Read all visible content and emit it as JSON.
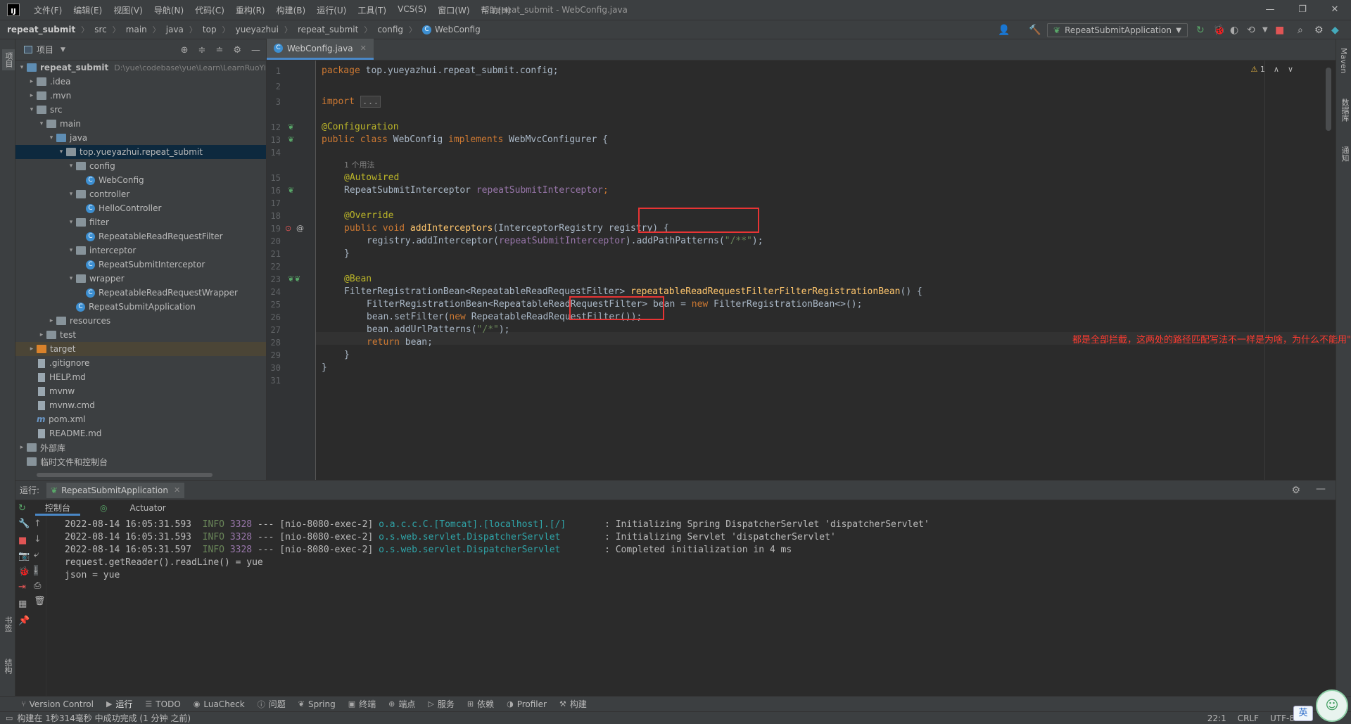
{
  "window": {
    "title": "repeat_submit - WebConfig.java",
    "menu": [
      "文件(F)",
      "编辑(E)",
      "视图(V)",
      "导航(N)",
      "代码(C)",
      "重构(R)",
      "构建(B)",
      "运行(U)",
      "工具(T)",
      "VCS(S)",
      "窗口(W)",
      "帮助(H)"
    ],
    "controls": {
      "minimize": "—",
      "maximize": "❐",
      "close": "✕"
    }
  },
  "breadcrumb": [
    "repeat_submit",
    "src",
    "main",
    "java",
    "top",
    "yueyazhui",
    "repeat_submit",
    "config",
    "WebConfig"
  ],
  "toolbar": {
    "run_config": "RepeatSubmitApplication"
  },
  "project_panel": {
    "title": "项目",
    "tree": [
      {
        "label": "repeat_submit",
        "hint": "D:\\yue\\codebase\\yue\\Learn\\LearnRuoYi",
        "depth": 0,
        "icon": "folder-blue",
        "arrow": "▾",
        "bold": true
      },
      {
        "label": ".idea",
        "depth": 1,
        "icon": "folder",
        "arrow": "▸"
      },
      {
        "label": ".mvn",
        "depth": 1,
        "icon": "folder",
        "arrow": "▸"
      },
      {
        "label": "src",
        "depth": 1,
        "icon": "folder",
        "arrow": "▾"
      },
      {
        "label": "main",
        "depth": 2,
        "icon": "folder",
        "arrow": "▾"
      },
      {
        "label": "java",
        "depth": 3,
        "icon": "folder-src",
        "arrow": "▾"
      },
      {
        "label": "top.yueyazhui.repeat_submit",
        "depth": 4,
        "icon": "pkg",
        "arrow": "▾",
        "selected": true
      },
      {
        "label": "config",
        "depth": 5,
        "icon": "pkg",
        "arrow": "▾"
      },
      {
        "label": "WebConfig",
        "depth": 6,
        "icon": "cls",
        "arrow": ""
      },
      {
        "label": "controller",
        "depth": 5,
        "icon": "pkg",
        "arrow": "▾"
      },
      {
        "label": "HelloController",
        "depth": 6,
        "icon": "cls",
        "arrow": ""
      },
      {
        "label": "filter",
        "depth": 5,
        "icon": "pkg",
        "arrow": "▾"
      },
      {
        "label": "RepeatableReadRequestFilter",
        "depth": 6,
        "icon": "cls",
        "arrow": ""
      },
      {
        "label": "interceptor",
        "depth": 5,
        "icon": "pkg",
        "arrow": "▾"
      },
      {
        "label": "RepeatSubmitInterceptor",
        "depth": 6,
        "icon": "cls",
        "arrow": ""
      },
      {
        "label": "wrapper",
        "depth": 5,
        "icon": "pkg",
        "arrow": "▾"
      },
      {
        "label": "RepeatableReadRequestWrapper",
        "depth": 6,
        "icon": "cls",
        "arrow": ""
      },
      {
        "label": "RepeatSubmitApplication",
        "depth": 5,
        "icon": "cls",
        "arrow": ""
      },
      {
        "label": "resources",
        "depth": 3,
        "icon": "folder",
        "arrow": "▸"
      },
      {
        "label": "test",
        "depth": 2,
        "icon": "folder",
        "arrow": "▸"
      },
      {
        "label": "target",
        "depth": 1,
        "icon": "folder-orange",
        "arrow": "▸",
        "excluded": true
      },
      {
        "label": ".gitignore",
        "depth": 1,
        "icon": "file",
        "arrow": ""
      },
      {
        "label": "HELP.md",
        "depth": 1,
        "icon": "file",
        "arrow": ""
      },
      {
        "label": "mvnw",
        "depth": 1,
        "icon": "file",
        "arrow": ""
      },
      {
        "label": "mvnw.cmd",
        "depth": 1,
        "icon": "file",
        "arrow": ""
      },
      {
        "label": "pom.xml",
        "depth": 1,
        "icon": "maven",
        "arrow": ""
      },
      {
        "label": "README.md",
        "depth": 1,
        "icon": "file",
        "arrow": ""
      },
      {
        "label": "外部库",
        "depth": 0,
        "icon": "folder",
        "arrow": "▸"
      },
      {
        "label": "临时文件和控制台",
        "depth": 0,
        "icon": "folder",
        "arrow": ""
      }
    ]
  },
  "editor": {
    "tab_label": "WebConfig.java",
    "warning_count": "1",
    "line_numbers": [
      "1",
      "2",
      "3",
      "12",
      "13",
      "14",
      "",
      "15",
      "16",
      "17",
      "18",
      "19",
      "20",
      "21",
      "22",
      "23",
      "24",
      "25",
      "26",
      "27",
      "28",
      "29",
      "30",
      "31"
    ],
    "usage_hint": "1 个用法",
    "lines": {
      "l1_kw": "package ",
      "l1_rest": "top.yueyazhui.repeat_submit.config;",
      "l3_kw": "import ",
      "l3_fold": "...",
      "l12": "@Configuration",
      "l13_kw1": "public class ",
      "l13_name": "WebConfig ",
      "l13_kw2": "implements ",
      "l13_rest": "WebMvcConfigurer {",
      "l15": "@Autowired",
      "l16_type": "RepeatSubmitInterceptor ",
      "l16_field": "repeatSubmitInterceptor",
      "l16_end": ";",
      "l18": "@Override",
      "l19_kw": "public void ",
      "l19_fn": "addInterceptors",
      "l19_rest": "(InterceptorRegistry registry) {",
      "l20_a": "registry.addInterceptor(",
      "l20_field": "repeatSubmitInterceptor",
      "l20_b": ").addPathPatterns(",
      "l20_str": "\"/**\"",
      "l20_c": ");",
      "l21": "}",
      "l23": "@Bean",
      "l24_a": "FilterRegistrationBean<RepeatableReadRequestFilter> ",
      "l24_fn": "repeatableReadRequestFilterFilterRegistrationBean",
      "l24_b": "() {",
      "l25_a": "FilterRegistrationBean<RepeatableReadRequestFilter> bean = ",
      "l25_kw": "new ",
      "l25_b": "FilterRegistrationBean<>();",
      "l26_a": "bean.setFilter(",
      "l26_kw": "new ",
      "l26_b": "RepeatableReadRequestFilter());",
      "l27_a": "bean.addUrlPatterns(",
      "l27_str": "\"/*\"",
      "l27_b": ");",
      "l28_kw": "return ",
      "l28_b": "bean;",
      "l29": "}",
      "l30": "}"
    },
    "annotation": "都是全部拦截，这两处的路径匹配写法不一样是为啥，为什么不能用\"*\""
  },
  "run_panel": {
    "label": "运行:",
    "tab": "RepeatSubmitApplication",
    "subtabs": [
      "控制台",
      "Actuator"
    ],
    "console": [
      {
        "ts": "2022-08-14 16:05:31.593",
        "level": "INFO",
        "pid": "3328",
        "sep": "---",
        "thread": "[nio-8080-exec-2]",
        "logger": "o.a.c.c.C.[Tomcat].[localhost].[/]      ",
        "msg": ": Initializing Spring DispatcherServlet 'dispatcherServlet'"
      },
      {
        "ts": "2022-08-14 16:05:31.593",
        "level": "INFO",
        "pid": "3328",
        "sep": "---",
        "thread": "[nio-8080-exec-2]",
        "logger": "o.s.web.servlet.DispatcherServlet       ",
        "msg": ": Initializing Servlet 'dispatcherServlet'"
      },
      {
        "ts": "2022-08-14 16:05:31.597",
        "level": "INFO",
        "pid": "3328",
        "sep": "---",
        "thread": "[nio-8080-exec-2]",
        "logger": "o.s.web.servlet.DispatcherServlet       ",
        "msg": ": Completed initialization in 4 ms"
      }
    ],
    "plain_lines": [
      "request.getReader().readLine() = yue",
      "json = yue"
    ]
  },
  "bottom_tools": [
    "Version Control",
    "运行",
    "TODO",
    "LuaCheck",
    "问题",
    "Spring",
    "终端",
    "端点",
    "服务",
    "依赖",
    "Profiler",
    "构建"
  ],
  "side_tools": {
    "left_top": "项目",
    "left_bottom_1": "书签",
    "left_bottom_2": "结构",
    "right_1": "Maven",
    "right_2": "数据库",
    "right_3": "通知"
  },
  "status": {
    "message": "构建在 1秒314毫秒 中成功完成 (1 分钟 之前)",
    "position": "22:1",
    "line_sep": "CRLF",
    "encoding": "UTF-8",
    "ime": "英"
  },
  "colors": {
    "accent": "#4a88c7",
    "annotation": "#ff3b30",
    "redbox": "#e83434"
  }
}
